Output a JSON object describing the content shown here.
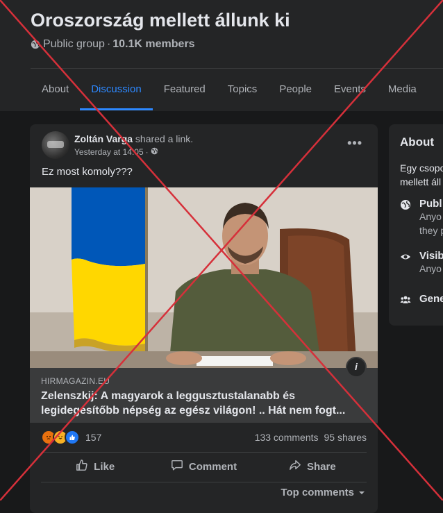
{
  "group": {
    "name": "Oroszország mellett állunk ki",
    "privacy": "Public group",
    "separator": "·",
    "members": "10.1K members"
  },
  "tabs": [
    "About",
    "Discussion",
    "Featured",
    "Topics",
    "People",
    "Events",
    "Media"
  ],
  "active_tab": "Discussion",
  "post": {
    "author": "Zoltán Varga",
    "action": "shared a link.",
    "time": "Yesterday at 14:05",
    "separator": "·",
    "text": "Ez most komoly???",
    "more_label": "•••",
    "link": {
      "domain": "HIRMAGAZIN.EU",
      "title": "Zelenszkij: A magyarok a leggusztustalanabb és legidegesítőbb népség az egész világon! .. Hát nem fogt...",
      "info_label": "i"
    },
    "reactions_count": "157",
    "comments": "133 comments",
    "shares": "95 shares",
    "actions": {
      "like": "Like",
      "comment": "Comment",
      "share": "Share"
    },
    "sort_label": "Top comments"
  },
  "about": {
    "title": "About",
    "description_lines": [
      "Egy csopo",
      "mellett áll"
    ],
    "public": {
      "title": "Publ",
      "lines": [
        "Anyo",
        "they p"
      ]
    },
    "visible": {
      "title": "Visib",
      "lines": [
        "Anyo"
      ]
    },
    "general": {
      "title": "Gene"
    }
  },
  "colors": {
    "background": "#18191a",
    "card": "#242526",
    "accent": "#2d88ff",
    "overlay_cross": "#d6303a",
    "flag_blue": "#0057b8",
    "flag_yellow": "#ffd700"
  },
  "icons": [
    "globe-icon",
    "ellipsis-icon",
    "info-icon",
    "like-icon",
    "comment-icon",
    "share-icon",
    "chevron-down-icon",
    "eye-icon",
    "group-icon"
  ]
}
